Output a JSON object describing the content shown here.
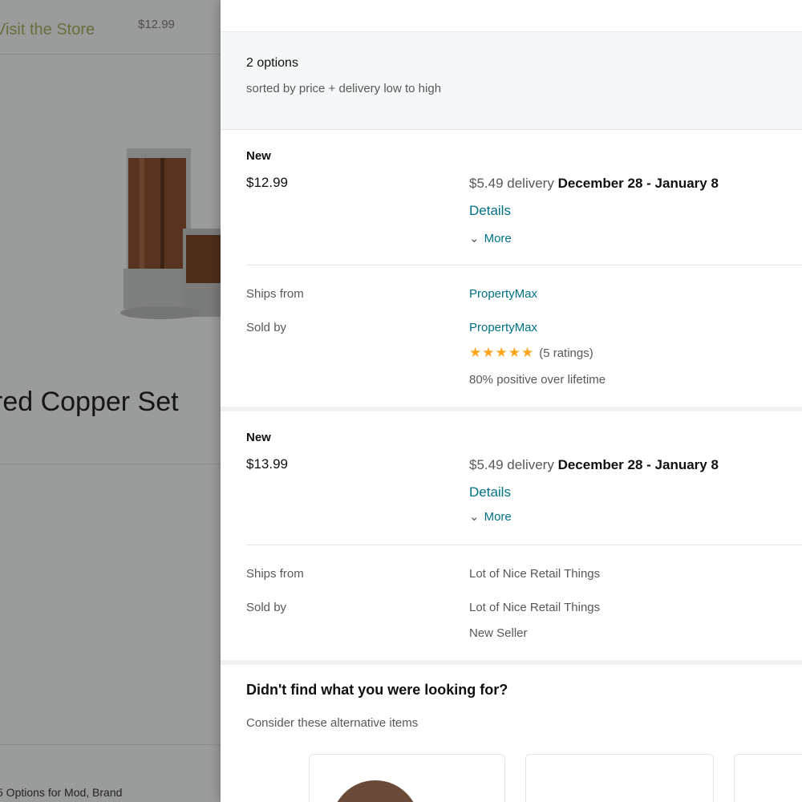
{
  "background": {
    "nav_link": "Visit the Store",
    "nav_price": "$12.99",
    "product_title": "red Copper Set",
    "footer_text": "5 Options for Mod, Brand"
  },
  "panel": {
    "options_count": "2 options",
    "sorted_by": "sorted by price + delivery low to high",
    "offers": [
      {
        "condition": "New",
        "price": "$12.99",
        "delivery_prefix": "$5.49 delivery",
        "delivery_dates": "December 28 - January 8",
        "details_label": "Details",
        "more_label": "More",
        "ships_from_label": "Ships from",
        "ships_from_value": "PropertyMax",
        "sold_by_label": "Sold by",
        "sold_by_value": "PropertyMax",
        "stars": "★★★★★",
        "ratings": "(5 ratings)",
        "positive": "80% positive over lifetime"
      },
      {
        "condition": "New",
        "price": "$13.99",
        "delivery_prefix": "$5.49 delivery",
        "delivery_dates": "December 28 - January 8",
        "details_label": "Details",
        "more_label": "More",
        "ships_from_label": "Ships from",
        "ships_from_value": "Lot of Nice Retail Things",
        "sold_by_label": "Sold by",
        "sold_by_value": "Lot of Nice Retail Things",
        "new_seller": "New Seller"
      }
    ],
    "alternatives_title": "Didn't find what you were looking for?",
    "alternatives_subtitle": "Consider these alternative items"
  },
  "colors": {
    "link": "#007185",
    "star": "#ffa41c",
    "overlay": "rgba(15,17,17,0.42)",
    "header_bg": "#f5f8f9"
  },
  "icons": {
    "more_toggle": "chevron-down-icon"
  }
}
